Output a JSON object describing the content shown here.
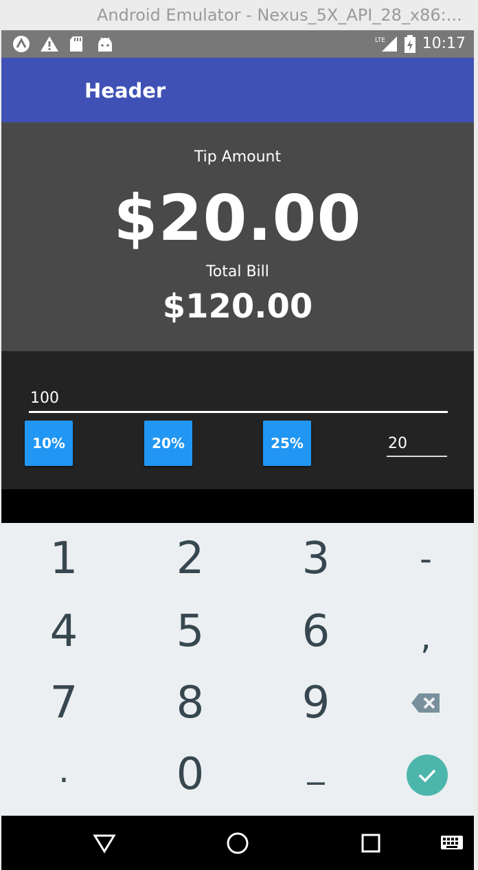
{
  "window": {
    "title": "Android Emulator - Nexus_5X_API_28_x86:..."
  },
  "status_bar": {
    "icons": [
      "app-a-icon",
      "warning-icon",
      "sd-card-icon",
      "android-icon",
      "lte-signal-icon",
      "battery-charging-icon"
    ],
    "network_label": "LTE",
    "time": "10:17"
  },
  "app_bar": {
    "title": "Header"
  },
  "summary": {
    "tip_label": "Tip Amount",
    "tip_value": "$20.00",
    "total_label": "Total Bill",
    "total_value": "$120.00"
  },
  "inputs": {
    "bill_value": "100",
    "percent_buttons": [
      "10%",
      "20%",
      "25%"
    ],
    "tip_percent_value": "20"
  },
  "keyboard": {
    "keys": [
      "1",
      "2",
      "3",
      "-",
      "4",
      "5",
      "6",
      ",",
      "7",
      "8",
      "9",
      "backspace-icon",
      ".",
      "0",
      "_",
      "done-icon"
    ]
  },
  "nav_bar": {
    "icons": [
      "back-icon",
      "home-icon",
      "recents-icon",
      "keyboard-icon"
    ]
  },
  "colors": {
    "app_bar": "#3f51b5",
    "summary_bg": "#494949",
    "input_bg": "#232323",
    "button": "#2196f3",
    "keyboard_bg": "#eceff1",
    "key_text": "#37474f",
    "done_key": "#4db6ac"
  }
}
